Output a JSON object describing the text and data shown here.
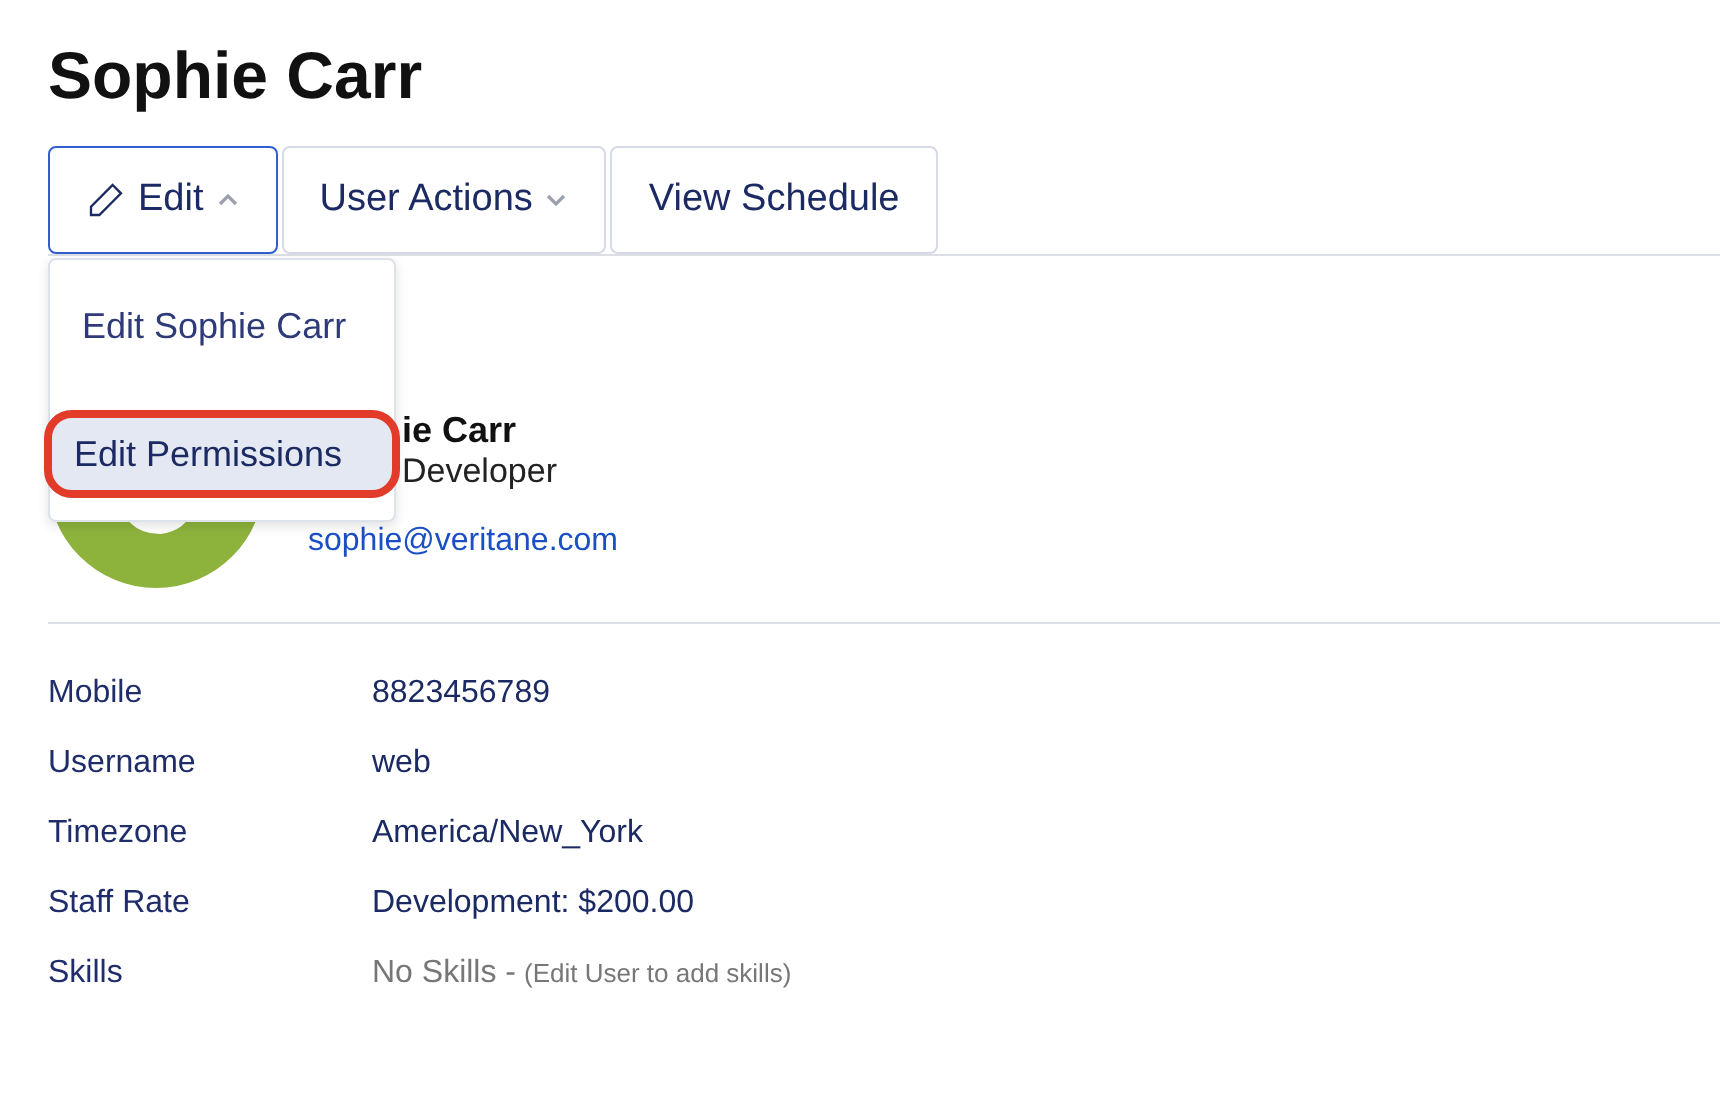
{
  "title": "Sophie Carr",
  "toolbar": [
    {
      "label": "Edit",
      "kind": "edit",
      "expanded": true
    },
    {
      "label": "User Actions",
      "kind": "menu",
      "expanded": false
    },
    {
      "label": "View Schedule",
      "kind": "plain",
      "expanded": false
    }
  ],
  "dropdown": [
    {
      "label": "Edit Sophie Carr",
      "selected": false,
      "highlighted": false
    },
    {
      "label": "Edit Permissions",
      "selected": true,
      "highlighted": true
    }
  ],
  "profile": {
    "name": "ie Carr",
    "role": "Developer",
    "email": "sophie@veritane.com"
  },
  "details": [
    {
      "label": "Mobile",
      "value": "8823456789"
    },
    {
      "label": "Username",
      "value": "web"
    },
    {
      "label": "Timezone",
      "value": "America/New_York"
    },
    {
      "label": "Staff Rate",
      "value": "Development: $200.00"
    },
    {
      "label": "Skills",
      "value": "No Skills -",
      "note": "(Edit User to add skills)",
      "kind": "empty"
    }
  ]
}
